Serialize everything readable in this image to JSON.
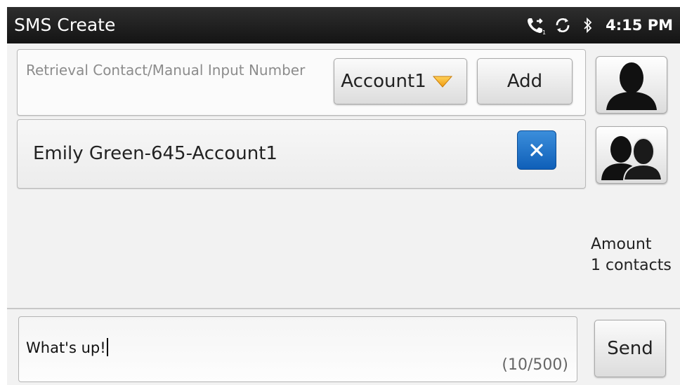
{
  "titlebar": {
    "title": "SMS Create",
    "time": "4:15 PM",
    "icons": [
      "call-forward-icon",
      "sync-icon",
      "bluetooth-icon"
    ]
  },
  "recipient": {
    "placeholder": "Retrieval Contact/Manual Input Number",
    "account_label": "Account1",
    "add_label": "Add"
  },
  "contacts": [
    {
      "label": "Emily Green-645-Account1"
    }
  ],
  "side_buttons": {
    "single_contact_icon": "person-icon",
    "group_contact_icon": "group-icon"
  },
  "amount": {
    "label": "Amount",
    "count": "1 contacts"
  },
  "message": {
    "text": "What's up!",
    "counter": "(10/500)",
    "send_label": "Send"
  },
  "colors": {
    "titlebar": "#1e1e1e",
    "accent_blue": "#1a6fc9",
    "dropdown_arrow": "#f2a516"
  }
}
